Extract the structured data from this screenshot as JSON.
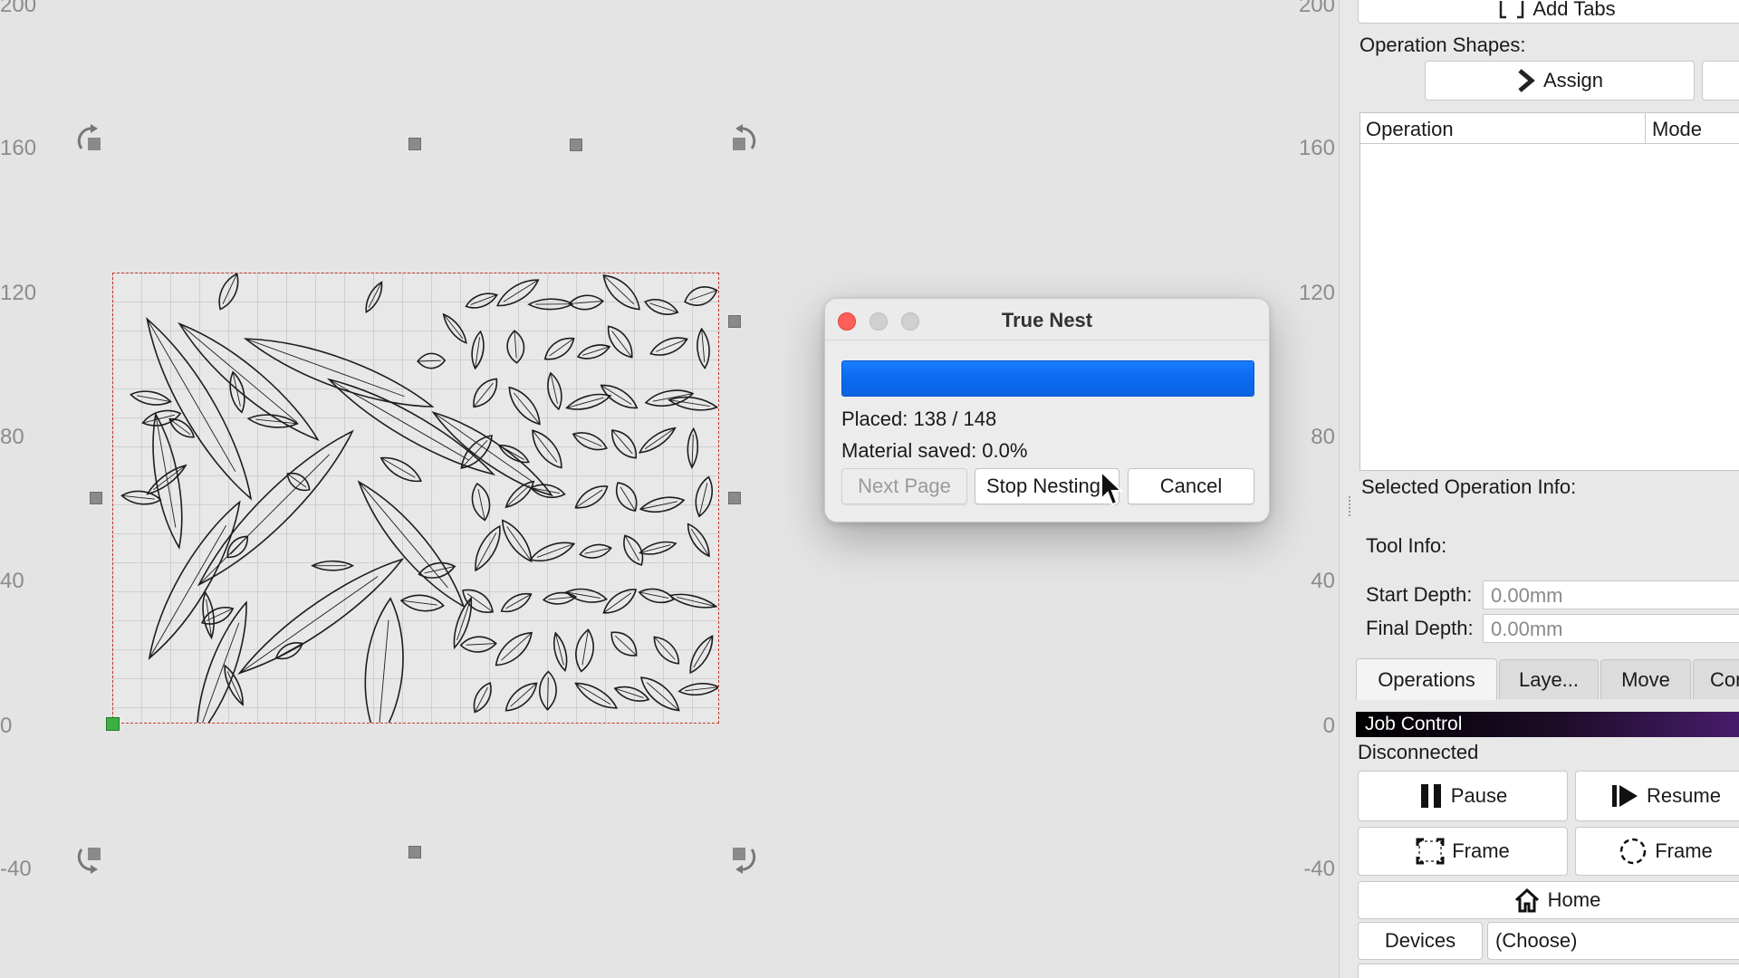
{
  "canvas": {
    "ruler_left": [
      "200",
      "160",
      "120",
      "80",
      "40",
      "0",
      "-40"
    ],
    "ruler_right": [
      "200",
      "160",
      "120",
      "80",
      "40",
      "0",
      "-40"
    ]
  },
  "dialog": {
    "title": "True Nest",
    "progress": 1.0,
    "placed": "Placed: 138 / 148",
    "material_saved": "Material saved: 0.0%",
    "buttons": {
      "next_page": "Next Page",
      "stop_nesting": "Stop Nesting",
      "cancel": "Cancel"
    }
  },
  "panel": {
    "add_tabs": "Add Tabs",
    "operation_shapes_label": "Operation Shapes:",
    "assign_button": "Assign",
    "ops_table": {
      "col_operation": "Operation",
      "col_mode": "Mode"
    },
    "selected_info_label": "Selected Operation Info:",
    "tool_info_label": "Tool Info:",
    "start_depth_label": "Start Depth:",
    "start_depth_value": "0.00mm",
    "final_depth_label": "Final Depth:",
    "final_depth_value": "0.00mm",
    "tabs": [
      "Operations",
      "Laye...",
      "Move",
      "Cor"
    ],
    "job_control": "Job Control",
    "status": "Disconnected",
    "pause": "Pause",
    "resume": "Resume",
    "frame_rect": "Frame",
    "frame_circle": "Frame",
    "home": "Home",
    "devices": "Devices",
    "device_choice": "(Choose)"
  },
  "colors": {
    "progress": "#0a6af0",
    "origin": "#3cb043",
    "boundary": "#c0392b"
  }
}
